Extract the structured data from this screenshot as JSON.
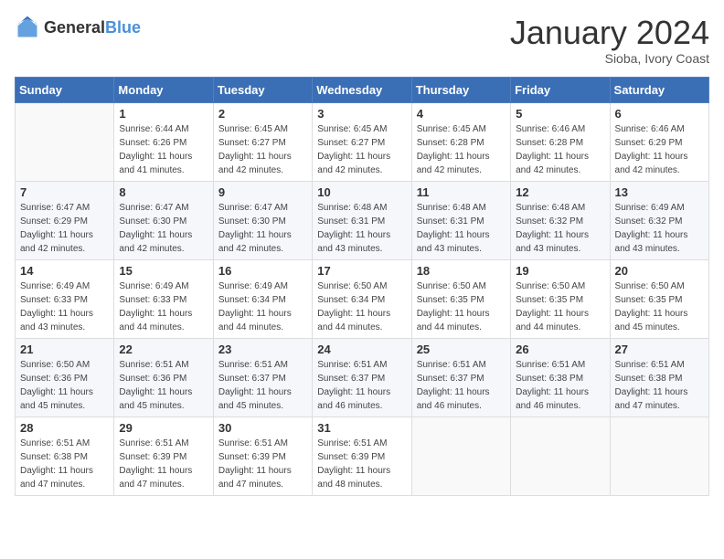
{
  "header": {
    "logo_general": "General",
    "logo_blue": "Blue",
    "month_title": "January 2024",
    "subtitle": "Sioba, Ivory Coast"
  },
  "days_of_week": [
    "Sunday",
    "Monday",
    "Tuesday",
    "Wednesday",
    "Thursday",
    "Friday",
    "Saturday"
  ],
  "weeks": [
    [
      {
        "day": "",
        "sunrise": "",
        "sunset": "",
        "daylight": ""
      },
      {
        "day": "1",
        "sunrise": "Sunrise: 6:44 AM",
        "sunset": "Sunset: 6:26 PM",
        "daylight": "Daylight: 11 hours and 41 minutes."
      },
      {
        "day": "2",
        "sunrise": "Sunrise: 6:45 AM",
        "sunset": "Sunset: 6:27 PM",
        "daylight": "Daylight: 11 hours and 42 minutes."
      },
      {
        "day": "3",
        "sunrise": "Sunrise: 6:45 AM",
        "sunset": "Sunset: 6:27 PM",
        "daylight": "Daylight: 11 hours and 42 minutes."
      },
      {
        "day": "4",
        "sunrise": "Sunrise: 6:45 AM",
        "sunset": "Sunset: 6:28 PM",
        "daylight": "Daylight: 11 hours and 42 minutes."
      },
      {
        "day": "5",
        "sunrise": "Sunrise: 6:46 AM",
        "sunset": "Sunset: 6:28 PM",
        "daylight": "Daylight: 11 hours and 42 minutes."
      },
      {
        "day": "6",
        "sunrise": "Sunrise: 6:46 AM",
        "sunset": "Sunset: 6:29 PM",
        "daylight": "Daylight: 11 hours and 42 minutes."
      }
    ],
    [
      {
        "day": "7",
        "sunrise": "Sunrise: 6:47 AM",
        "sunset": "Sunset: 6:29 PM",
        "daylight": "Daylight: 11 hours and 42 minutes."
      },
      {
        "day": "8",
        "sunrise": "Sunrise: 6:47 AM",
        "sunset": "Sunset: 6:30 PM",
        "daylight": "Daylight: 11 hours and 42 minutes."
      },
      {
        "day": "9",
        "sunrise": "Sunrise: 6:47 AM",
        "sunset": "Sunset: 6:30 PM",
        "daylight": "Daylight: 11 hours and 42 minutes."
      },
      {
        "day": "10",
        "sunrise": "Sunrise: 6:48 AM",
        "sunset": "Sunset: 6:31 PM",
        "daylight": "Daylight: 11 hours and 43 minutes."
      },
      {
        "day": "11",
        "sunrise": "Sunrise: 6:48 AM",
        "sunset": "Sunset: 6:31 PM",
        "daylight": "Daylight: 11 hours and 43 minutes."
      },
      {
        "day": "12",
        "sunrise": "Sunrise: 6:48 AM",
        "sunset": "Sunset: 6:32 PM",
        "daylight": "Daylight: 11 hours and 43 minutes."
      },
      {
        "day": "13",
        "sunrise": "Sunrise: 6:49 AM",
        "sunset": "Sunset: 6:32 PM",
        "daylight": "Daylight: 11 hours and 43 minutes."
      }
    ],
    [
      {
        "day": "14",
        "sunrise": "Sunrise: 6:49 AM",
        "sunset": "Sunset: 6:33 PM",
        "daylight": "Daylight: 11 hours and 43 minutes."
      },
      {
        "day": "15",
        "sunrise": "Sunrise: 6:49 AM",
        "sunset": "Sunset: 6:33 PM",
        "daylight": "Daylight: 11 hours and 44 minutes."
      },
      {
        "day": "16",
        "sunrise": "Sunrise: 6:49 AM",
        "sunset": "Sunset: 6:34 PM",
        "daylight": "Daylight: 11 hours and 44 minutes."
      },
      {
        "day": "17",
        "sunrise": "Sunrise: 6:50 AM",
        "sunset": "Sunset: 6:34 PM",
        "daylight": "Daylight: 11 hours and 44 minutes."
      },
      {
        "day": "18",
        "sunrise": "Sunrise: 6:50 AM",
        "sunset": "Sunset: 6:35 PM",
        "daylight": "Daylight: 11 hours and 44 minutes."
      },
      {
        "day": "19",
        "sunrise": "Sunrise: 6:50 AM",
        "sunset": "Sunset: 6:35 PM",
        "daylight": "Daylight: 11 hours and 44 minutes."
      },
      {
        "day": "20",
        "sunrise": "Sunrise: 6:50 AM",
        "sunset": "Sunset: 6:35 PM",
        "daylight": "Daylight: 11 hours and 45 minutes."
      }
    ],
    [
      {
        "day": "21",
        "sunrise": "Sunrise: 6:50 AM",
        "sunset": "Sunset: 6:36 PM",
        "daylight": "Daylight: 11 hours and 45 minutes."
      },
      {
        "day": "22",
        "sunrise": "Sunrise: 6:51 AM",
        "sunset": "Sunset: 6:36 PM",
        "daylight": "Daylight: 11 hours and 45 minutes."
      },
      {
        "day": "23",
        "sunrise": "Sunrise: 6:51 AM",
        "sunset": "Sunset: 6:37 PM",
        "daylight": "Daylight: 11 hours and 45 minutes."
      },
      {
        "day": "24",
        "sunrise": "Sunrise: 6:51 AM",
        "sunset": "Sunset: 6:37 PM",
        "daylight": "Daylight: 11 hours and 46 minutes."
      },
      {
        "day": "25",
        "sunrise": "Sunrise: 6:51 AM",
        "sunset": "Sunset: 6:37 PM",
        "daylight": "Daylight: 11 hours and 46 minutes."
      },
      {
        "day": "26",
        "sunrise": "Sunrise: 6:51 AM",
        "sunset": "Sunset: 6:38 PM",
        "daylight": "Daylight: 11 hours and 46 minutes."
      },
      {
        "day": "27",
        "sunrise": "Sunrise: 6:51 AM",
        "sunset": "Sunset: 6:38 PM",
        "daylight": "Daylight: 11 hours and 47 minutes."
      }
    ],
    [
      {
        "day": "28",
        "sunrise": "Sunrise: 6:51 AM",
        "sunset": "Sunset: 6:38 PM",
        "daylight": "Daylight: 11 hours and 47 minutes."
      },
      {
        "day": "29",
        "sunrise": "Sunrise: 6:51 AM",
        "sunset": "Sunset: 6:39 PM",
        "daylight": "Daylight: 11 hours and 47 minutes."
      },
      {
        "day": "30",
        "sunrise": "Sunrise: 6:51 AM",
        "sunset": "Sunset: 6:39 PM",
        "daylight": "Daylight: 11 hours and 47 minutes."
      },
      {
        "day": "31",
        "sunrise": "Sunrise: 6:51 AM",
        "sunset": "Sunset: 6:39 PM",
        "daylight": "Daylight: 11 hours and 48 minutes."
      },
      {
        "day": "",
        "sunrise": "",
        "sunset": "",
        "daylight": ""
      },
      {
        "day": "",
        "sunrise": "",
        "sunset": "",
        "daylight": ""
      },
      {
        "day": "",
        "sunrise": "",
        "sunset": "",
        "daylight": ""
      }
    ]
  ]
}
